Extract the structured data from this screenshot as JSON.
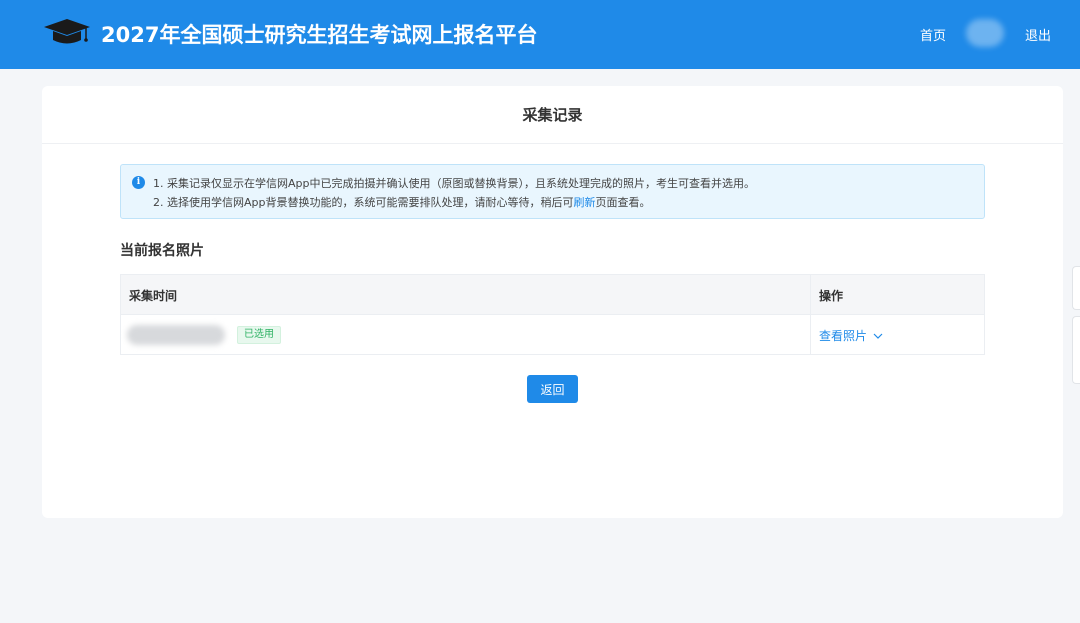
{
  "header": {
    "site_title": "2027年全国硕士研究生招生考试网上报名平台",
    "nav_home": "首页",
    "nav_logout": "退出",
    "logo_icon": "graduation-cap-icon",
    "bg_color": "#1f8ae8"
  },
  "card": {
    "title": "采集记录"
  },
  "notice": {
    "icon": "info-icon",
    "icon_glyph": "i",
    "line1": "1. 采集记录仅显示在学信网App中已完成拍摄并确认使用（原图或替换背景），且系统处理完成的照片，考生可查看并选用。",
    "line2_before": "2. 选择使用学信网App背景替换功能的，系统可能需要排队处理，请耐心等待，稍后可",
    "line2_link": "刷新",
    "line2_after": "页面查看。"
  },
  "section": {
    "title": "当前报名照片"
  },
  "table": {
    "columns": [
      "采集时间",
      "操作"
    ],
    "rows": [
      {
        "status_badge": "已选用",
        "action": "查看照片"
      }
    ]
  },
  "buttons": {
    "back": "返回"
  },
  "colors": {
    "accent": "#1f8ae8",
    "badge_green": "#2fb264",
    "notice_bg": "#e9f6fe"
  }
}
